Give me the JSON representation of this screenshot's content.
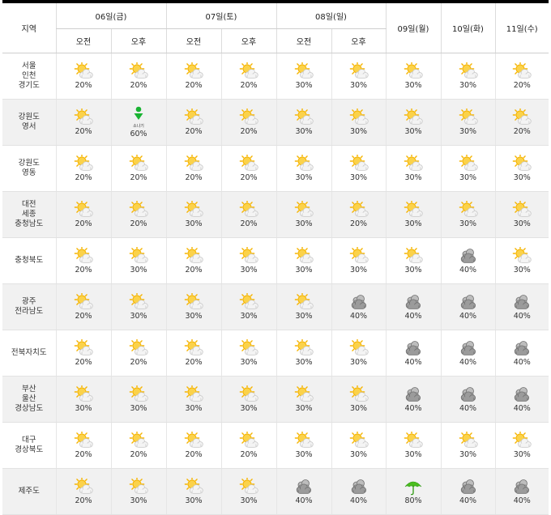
{
  "header": {
    "region_label": "지역",
    "days": [
      {
        "label": "06일(금)",
        "split": true
      },
      {
        "label": "07일(토)",
        "split": true
      },
      {
        "label": "08일(일)",
        "split": true
      },
      {
        "label": "09일(월)",
        "split": false
      },
      {
        "label": "10일(화)",
        "split": false
      },
      {
        "label": "11일(수)",
        "split": false
      }
    ],
    "am_label": "오전",
    "pm_label": "오후"
  },
  "rows": [
    {
      "region": [
        "서울",
        "인천",
        "경기도"
      ],
      "cells": [
        {
          "icon": "partly-cloudy-icon",
          "pct": "20%"
        },
        {
          "icon": "partly-cloudy-icon",
          "pct": "20%"
        },
        {
          "icon": "partly-cloudy-icon",
          "pct": "20%"
        },
        {
          "icon": "partly-cloudy-icon",
          "pct": "20%"
        },
        {
          "icon": "partly-cloudy-icon",
          "pct": "30%"
        },
        {
          "icon": "partly-cloudy-icon",
          "pct": "30%"
        },
        {
          "icon": "partly-cloudy-icon",
          "pct": "30%"
        },
        {
          "icon": "partly-cloudy-icon",
          "pct": "30%"
        },
        {
          "icon": "partly-cloudy-icon",
          "pct": "20%"
        }
      ]
    },
    {
      "region": [
        "강원도",
        "영서"
      ],
      "cells": [
        {
          "icon": "partly-cloudy-icon",
          "pct": "20%"
        },
        {
          "icon": "shower-icon",
          "pct": "60%",
          "badge": "소나기"
        },
        {
          "icon": "partly-cloudy-icon",
          "pct": "20%"
        },
        {
          "icon": "partly-cloudy-icon",
          "pct": "20%"
        },
        {
          "icon": "partly-cloudy-icon",
          "pct": "30%"
        },
        {
          "icon": "partly-cloudy-icon",
          "pct": "30%"
        },
        {
          "icon": "partly-cloudy-icon",
          "pct": "30%"
        },
        {
          "icon": "partly-cloudy-icon",
          "pct": "30%"
        },
        {
          "icon": "partly-cloudy-icon",
          "pct": "20%"
        }
      ]
    },
    {
      "region": [
        "강원도",
        "영동"
      ],
      "cells": [
        {
          "icon": "partly-cloudy-icon",
          "pct": "20%"
        },
        {
          "icon": "partly-cloudy-icon",
          "pct": "20%"
        },
        {
          "icon": "partly-cloudy-icon",
          "pct": "20%"
        },
        {
          "icon": "partly-cloudy-icon",
          "pct": "20%"
        },
        {
          "icon": "partly-cloudy-icon",
          "pct": "30%"
        },
        {
          "icon": "partly-cloudy-icon",
          "pct": "30%"
        },
        {
          "icon": "partly-cloudy-icon",
          "pct": "30%"
        },
        {
          "icon": "partly-cloudy-icon",
          "pct": "30%"
        },
        {
          "icon": "partly-cloudy-icon",
          "pct": "30%"
        }
      ]
    },
    {
      "region": [
        "대전",
        "세종",
        "충청남도"
      ],
      "cells": [
        {
          "icon": "partly-cloudy-icon",
          "pct": "20%"
        },
        {
          "icon": "partly-cloudy-icon",
          "pct": "20%"
        },
        {
          "icon": "partly-cloudy-icon",
          "pct": "30%"
        },
        {
          "icon": "partly-cloudy-icon",
          "pct": "20%"
        },
        {
          "icon": "partly-cloudy-icon",
          "pct": "30%"
        },
        {
          "icon": "partly-cloudy-icon",
          "pct": "20%"
        },
        {
          "icon": "partly-cloudy-icon",
          "pct": "30%"
        },
        {
          "icon": "partly-cloudy-icon",
          "pct": "30%"
        },
        {
          "icon": "partly-cloudy-icon",
          "pct": "30%"
        }
      ]
    },
    {
      "region": [
        "충청북도"
      ],
      "cells": [
        {
          "icon": "partly-cloudy-icon",
          "pct": "20%"
        },
        {
          "icon": "partly-cloudy-icon",
          "pct": "30%"
        },
        {
          "icon": "partly-cloudy-icon",
          "pct": "20%"
        },
        {
          "icon": "partly-cloudy-icon",
          "pct": "30%"
        },
        {
          "icon": "partly-cloudy-icon",
          "pct": "30%"
        },
        {
          "icon": "partly-cloudy-icon",
          "pct": "30%"
        },
        {
          "icon": "partly-cloudy-icon",
          "pct": "30%"
        },
        {
          "icon": "cloudy-icon",
          "pct": "40%"
        },
        {
          "icon": "partly-cloudy-icon",
          "pct": "30%"
        }
      ]
    },
    {
      "region": [
        "광주",
        "전라남도"
      ],
      "cells": [
        {
          "icon": "partly-cloudy-icon",
          "pct": "20%"
        },
        {
          "icon": "partly-cloudy-icon",
          "pct": "30%"
        },
        {
          "icon": "partly-cloudy-icon",
          "pct": "30%"
        },
        {
          "icon": "partly-cloudy-icon",
          "pct": "30%"
        },
        {
          "icon": "partly-cloudy-icon",
          "pct": "30%"
        },
        {
          "icon": "cloudy-icon",
          "pct": "40%"
        },
        {
          "icon": "cloudy-icon",
          "pct": "40%"
        },
        {
          "icon": "cloudy-icon",
          "pct": "40%"
        },
        {
          "icon": "cloudy-icon",
          "pct": "40%"
        }
      ]
    },
    {
      "region": [
        "전북자치도"
      ],
      "cells": [
        {
          "icon": "partly-cloudy-icon",
          "pct": "20%"
        },
        {
          "icon": "partly-cloudy-icon",
          "pct": "20%"
        },
        {
          "icon": "partly-cloudy-icon",
          "pct": "20%"
        },
        {
          "icon": "partly-cloudy-icon",
          "pct": "30%"
        },
        {
          "icon": "partly-cloudy-icon",
          "pct": "30%"
        },
        {
          "icon": "partly-cloudy-icon",
          "pct": "30%"
        },
        {
          "icon": "cloudy-icon",
          "pct": "40%"
        },
        {
          "icon": "cloudy-icon",
          "pct": "40%"
        },
        {
          "icon": "cloudy-icon",
          "pct": "40%"
        }
      ]
    },
    {
      "region": [
        "부산",
        "울산",
        "경상남도"
      ],
      "cells": [
        {
          "icon": "partly-cloudy-icon",
          "pct": "30%"
        },
        {
          "icon": "partly-cloudy-icon",
          "pct": "30%"
        },
        {
          "icon": "partly-cloudy-icon",
          "pct": "30%"
        },
        {
          "icon": "partly-cloudy-icon",
          "pct": "30%"
        },
        {
          "icon": "partly-cloudy-icon",
          "pct": "30%"
        },
        {
          "icon": "partly-cloudy-icon",
          "pct": "30%"
        },
        {
          "icon": "cloudy-icon",
          "pct": "40%"
        },
        {
          "icon": "cloudy-icon",
          "pct": "40%"
        },
        {
          "icon": "cloudy-icon",
          "pct": "40%"
        }
      ]
    },
    {
      "region": [
        "대구",
        "경상북도"
      ],
      "cells": [
        {
          "icon": "partly-cloudy-icon",
          "pct": "20%"
        },
        {
          "icon": "partly-cloudy-icon",
          "pct": "20%"
        },
        {
          "icon": "partly-cloudy-icon",
          "pct": "20%"
        },
        {
          "icon": "partly-cloudy-icon",
          "pct": "20%"
        },
        {
          "icon": "partly-cloudy-icon",
          "pct": "30%"
        },
        {
          "icon": "partly-cloudy-icon",
          "pct": "30%"
        },
        {
          "icon": "partly-cloudy-icon",
          "pct": "30%"
        },
        {
          "icon": "partly-cloudy-icon",
          "pct": "30%"
        },
        {
          "icon": "partly-cloudy-icon",
          "pct": "30%"
        }
      ]
    },
    {
      "region": [
        "제주도"
      ],
      "cells": [
        {
          "icon": "partly-cloudy-icon",
          "pct": "20%"
        },
        {
          "icon": "partly-cloudy-icon",
          "pct": "30%"
        },
        {
          "icon": "partly-cloudy-icon",
          "pct": "30%"
        },
        {
          "icon": "partly-cloudy-icon",
          "pct": "30%"
        },
        {
          "icon": "cloudy-icon",
          "pct": "40%"
        },
        {
          "icon": "cloudy-icon",
          "pct": "40%"
        },
        {
          "icon": "rain-umbrella-icon",
          "pct": "80%"
        },
        {
          "icon": "cloudy-icon",
          "pct": "40%"
        },
        {
          "icon": "cloudy-icon",
          "pct": "40%"
        }
      ]
    }
  ],
  "colors": {
    "sun": "#f5b400",
    "sun_light": "#fbd24a",
    "cloud": "#f4f4f4",
    "cloud_edge": "#c9c9c9",
    "dark_cloud": "#9b9b9b",
    "dark_cloud_edge": "#6f6f6f",
    "shower_green": "#19b332",
    "umbrella_green": "#4bbd1f",
    "header_rule": "#000000",
    "alt_row": "#f1f1f1"
  }
}
